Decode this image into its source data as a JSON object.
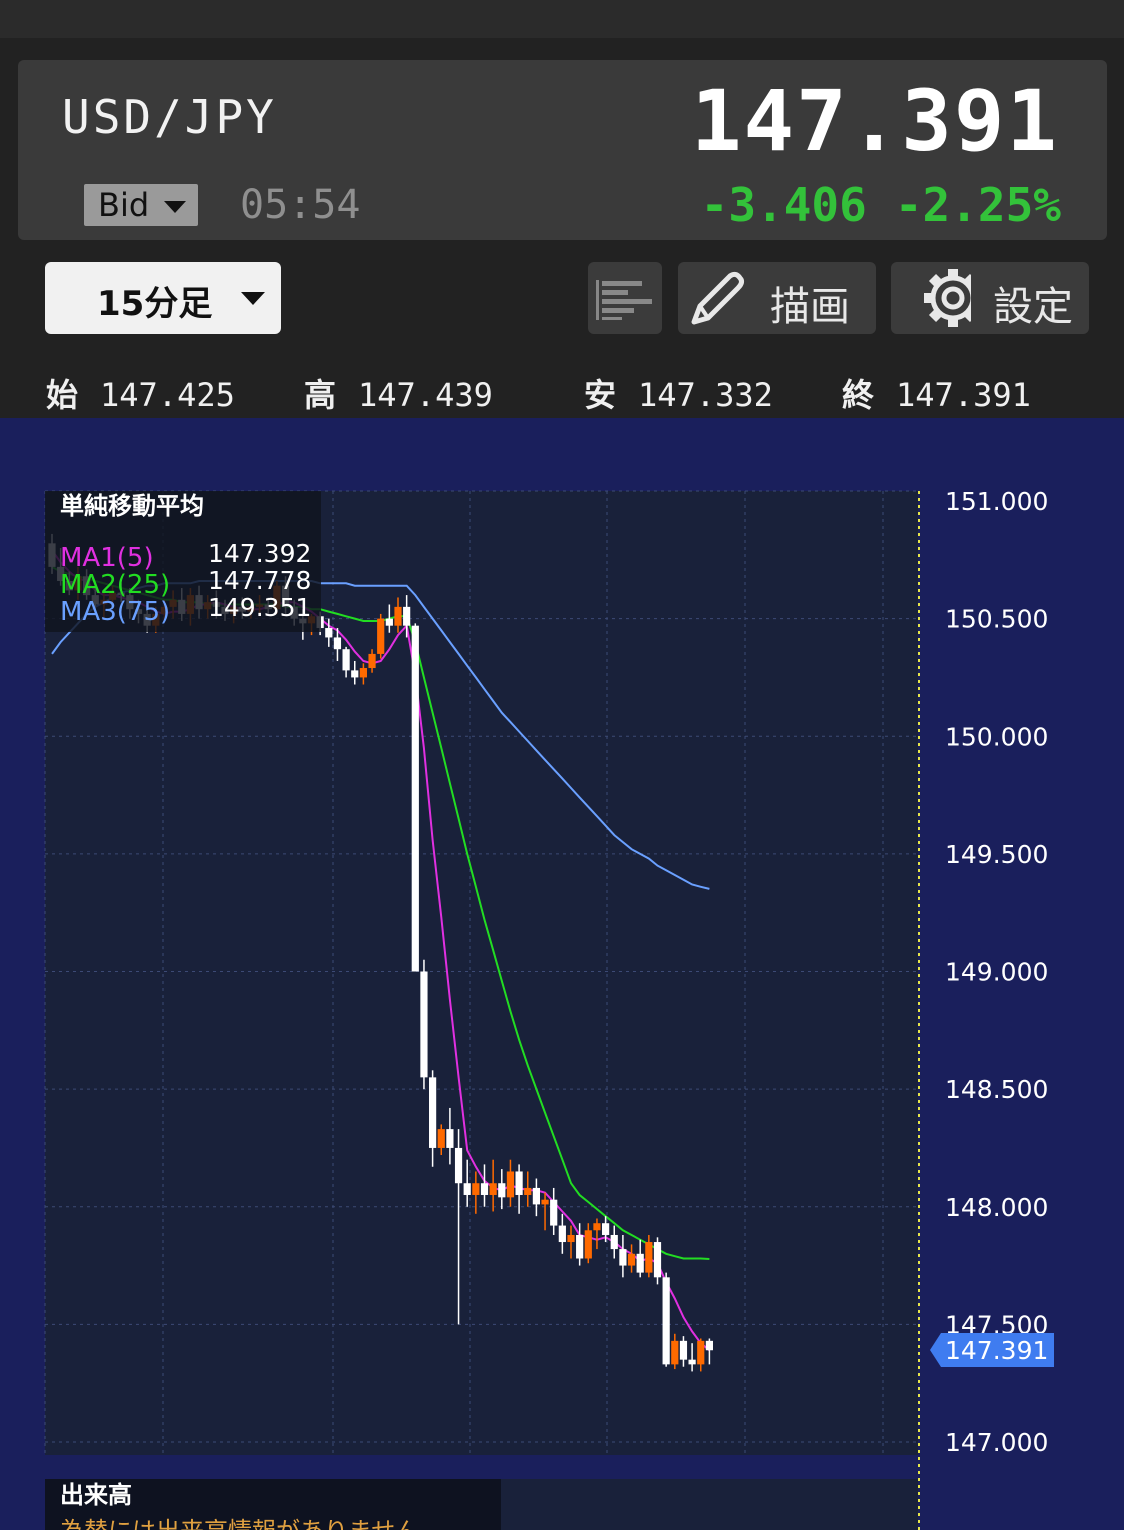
{
  "header": {
    "symbol": "USD/JPY",
    "price": "147.391",
    "price_type": "Bid",
    "time": "05:54",
    "change": "-3.406",
    "change_pct": "-2.25%",
    "down_color": "#33c23a"
  },
  "toolbar": {
    "timeframe": "15分足",
    "list_icon": "list-icon",
    "draw_label": "描画",
    "draw_icon": "pencil-icon",
    "settings_label": "設定",
    "settings_icon": "gear-icon"
  },
  "ohlc": {
    "open_label": "始",
    "open": "147.425",
    "high_label": "高",
    "high": "147.439",
    "low_label": "安",
    "low": "147.332",
    "close_label": "終",
    "close": "147.391"
  },
  "legend": {
    "title": "単純移動平均",
    "ma1_label": "MA1(5)",
    "ma1_value": "147.392",
    "ma1_color": "#e030e0",
    "ma2_label": "MA2(25)",
    "ma2_value": "147.778",
    "ma2_color": "#22dd22",
    "ma3_label": "MA3(75)",
    "ma3_value": "149.351",
    "ma3_color": "#6aa0ff"
  },
  "volume": {
    "title": "出来高",
    "message": "為替には出来高情報がありません"
  },
  "chart_data": {
    "type": "candlestick",
    "ylim": [
      147.0,
      151.0
    ],
    "y_ticks": [
      "151.000",
      "150.500",
      "150.000",
      "149.500",
      "149.000",
      "148.500",
      "148.000",
      "147.500",
      "147.000"
    ],
    "current_price_label": "147.391",
    "up_color": "#ff6a00",
    "down_color": "#ffffff",
    "candles": [
      [
        150.82,
        150.86,
        150.69,
        150.72
      ],
      [
        150.72,
        150.8,
        150.64,
        150.66
      ],
      [
        150.66,
        150.7,
        150.6,
        150.62
      ],
      [
        150.62,
        150.72,
        150.58,
        150.68
      ],
      [
        150.68,
        150.71,
        150.58,
        150.6
      ],
      [
        150.6,
        150.63,
        150.53,
        150.56
      ],
      [
        150.56,
        150.62,
        150.5,
        150.58
      ],
      [
        150.58,
        150.64,
        150.55,
        150.61
      ],
      [
        150.61,
        150.65,
        150.57,
        150.6
      ],
      [
        150.6,
        150.63,
        150.5,
        150.54
      ],
      [
        150.54,
        150.58,
        150.48,
        150.52
      ],
      [
        150.52,
        150.57,
        150.44,
        150.47
      ],
      [
        150.47,
        150.55,
        150.44,
        150.52
      ],
      [
        150.52,
        150.58,
        150.49,
        150.55
      ],
      [
        150.55,
        150.62,
        150.5,
        150.58
      ],
      [
        150.58,
        150.63,
        150.49,
        150.52
      ],
      [
        150.52,
        150.63,
        150.47,
        150.6
      ],
      [
        150.6,
        150.64,
        150.5,
        150.54
      ],
      [
        150.54,
        150.6,
        150.5,
        150.57
      ],
      [
        150.57,
        150.62,
        150.5,
        150.55
      ],
      [
        150.55,
        150.58,
        150.49,
        150.52
      ],
      [
        150.52,
        150.58,
        150.48,
        150.55
      ],
      [
        150.55,
        150.59,
        150.5,
        150.53
      ],
      [
        150.53,
        150.57,
        150.5,
        150.55
      ],
      [
        150.55,
        150.6,
        150.51,
        150.56
      ],
      [
        150.56,
        150.59,
        150.52,
        150.54
      ],
      [
        150.54,
        150.66,
        150.52,
        150.64
      ],
      [
        150.64,
        150.68,
        150.52,
        150.55
      ],
      [
        150.55,
        150.58,
        150.47,
        150.5
      ],
      [
        150.5,
        150.54,
        150.41,
        150.48
      ],
      [
        150.48,
        150.52,
        150.43,
        150.51
      ],
      [
        150.51,
        150.53,
        150.43,
        150.46
      ],
      [
        150.46,
        150.5,
        150.38,
        150.42
      ],
      [
        150.42,
        150.46,
        150.32,
        150.37
      ],
      [
        150.37,
        150.38,
        150.25,
        150.28
      ],
      [
        150.28,
        150.32,
        150.22,
        150.25
      ],
      [
        150.25,
        150.31,
        150.22,
        150.29
      ],
      [
        150.29,
        150.37,
        150.27,
        150.35
      ],
      [
        150.35,
        150.52,
        150.33,
        150.5
      ],
      [
        150.5,
        150.56,
        150.44,
        150.47
      ],
      [
        150.47,
        150.59,
        150.44,
        150.55
      ],
      [
        150.55,
        150.6,
        150.42,
        150.47
      ],
      [
        150.47,
        150.48,
        149.0,
        149.0
      ],
      [
        149.0,
        149.05,
        148.5,
        148.55
      ],
      [
        148.55,
        148.58,
        148.17,
        148.25
      ],
      [
        148.25,
        148.35,
        148.22,
        148.33
      ],
      [
        148.33,
        148.42,
        148.18,
        148.25
      ],
      [
        148.25,
        148.33,
        147.5,
        148.1
      ],
      [
        148.1,
        148.2,
        148.0,
        148.05
      ],
      [
        148.05,
        148.15,
        147.97,
        148.1
      ],
      [
        148.1,
        148.18,
        148.0,
        148.05
      ],
      [
        148.05,
        148.2,
        147.98,
        148.1
      ],
      [
        148.1,
        148.16,
        147.99,
        148.04
      ],
      [
        148.04,
        148.2,
        148.0,
        148.15
      ],
      [
        148.15,
        148.18,
        147.97,
        148.05
      ],
      [
        148.05,
        148.15,
        148.0,
        148.08
      ],
      [
        148.08,
        148.12,
        147.96,
        148.01
      ],
      [
        148.01,
        148.06,
        147.9,
        148.03
      ],
      [
        148.03,
        148.08,
        147.88,
        147.92
      ],
      [
        147.92,
        147.97,
        147.8,
        147.85
      ],
      [
        147.85,
        147.92,
        147.78,
        147.88
      ],
      [
        147.88,
        147.93,
        147.75,
        147.78
      ],
      [
        147.78,
        147.93,
        147.76,
        147.9
      ],
      [
        147.9,
        147.95,
        147.82,
        147.93
      ],
      [
        147.93,
        147.96,
        147.85,
        147.88
      ],
      [
        147.88,
        147.92,
        147.78,
        147.82
      ],
      [
        147.82,
        147.88,
        147.7,
        147.75
      ],
      [
        147.75,
        147.84,
        147.72,
        147.8
      ],
      [
        147.8,
        147.86,
        147.7,
        147.72
      ],
      [
        147.72,
        147.88,
        147.7,
        147.85
      ],
      [
        147.85,
        147.87,
        147.67,
        147.7
      ],
      [
        147.7,
        147.72,
        147.32,
        147.33
      ],
      [
        147.33,
        147.46,
        147.31,
        147.43
      ],
      [
        147.43,
        147.45,
        147.32,
        147.35
      ],
      [
        147.35,
        147.42,
        147.3,
        147.33
      ],
      [
        147.33,
        147.44,
        147.3,
        147.43
      ],
      [
        147.43,
        147.44,
        147.33,
        147.39
      ]
    ],
    "ma1_values": [
      150.79,
      150.74,
      150.7,
      150.67,
      150.66,
      150.62,
      150.6,
      150.6,
      150.59,
      150.58,
      150.57,
      150.55,
      150.53,
      150.52,
      150.53,
      150.53,
      150.54,
      150.56,
      150.56,
      150.57,
      150.56,
      150.55,
      150.54,
      150.54,
      150.54,
      150.55,
      150.56,
      150.57,
      150.57,
      150.55,
      150.53,
      150.5,
      150.47,
      150.45,
      150.41,
      150.36,
      150.32,
      150.31,
      150.32,
      150.37,
      150.43,
      150.47,
      150.26,
      149.95,
      149.56,
      149.23,
      148.88,
      148.55,
      148.24,
      148.17,
      148.11,
      148.08,
      148.07,
      148.09,
      148.08,
      148.07,
      148.07,
      148.06,
      148.02,
      147.98,
      147.94,
      147.88,
      147.87,
      147.86,
      147.87,
      147.85,
      147.82,
      147.8,
      147.77,
      147.78,
      147.76,
      147.68,
      147.61,
      147.53,
      147.47,
      147.42,
      147.39
    ],
    "ma2_values": [
      150.72,
      150.7,
      150.69,
      150.68,
      150.67,
      150.66,
      150.65,
      150.64,
      150.63,
      150.62,
      150.61,
      150.6,
      150.59,
      150.58,
      150.58,
      150.57,
      150.57,
      150.57,
      150.56,
      150.56,
      150.56,
      150.56,
      150.56,
      150.56,
      150.56,
      150.56,
      150.56,
      150.55,
      150.55,
      150.55,
      150.54,
      150.54,
      150.53,
      150.52,
      150.51,
      150.5,
      150.49,
      150.49,
      150.49,
      150.5,
      150.51,
      150.51,
      150.4,
      150.25,
      150.1,
      149.95,
      149.8,
      149.65,
      149.5,
      149.36,
      149.22,
      149.09,
      148.96,
      148.83,
      148.71,
      148.6,
      148.5,
      148.4,
      148.3,
      148.2,
      148.1,
      148.05,
      148.02,
      147.99,
      147.96,
      147.93,
      147.9,
      147.88,
      147.86,
      147.84,
      147.82,
      147.8,
      147.79,
      147.78,
      147.78,
      147.78,
      147.778
    ],
    "ma3_values": [
      150.35,
      150.4,
      150.44,
      150.48,
      150.52,
      150.55,
      150.57,
      150.59,
      150.61,
      150.62,
      150.63,
      150.64,
      150.64,
      150.65,
      150.65,
      150.65,
      150.65,
      150.66,
      150.66,
      150.66,
      150.66,
      150.66,
      150.66,
      150.66,
      150.66,
      150.66,
      150.66,
      150.66,
      150.66,
      150.66,
      150.66,
      150.65,
      150.65,
      150.65,
      150.65,
      150.64,
      150.64,
      150.64,
      150.64,
      150.64,
      150.64,
      150.64,
      150.6,
      150.55,
      150.5,
      150.45,
      150.4,
      150.35,
      150.3,
      150.25,
      150.2,
      150.15,
      150.1,
      150.06,
      150.02,
      149.98,
      149.94,
      149.9,
      149.86,
      149.82,
      149.78,
      149.74,
      149.7,
      149.66,
      149.62,
      149.58,
      149.55,
      149.52,
      149.5,
      149.48,
      149.45,
      149.43,
      149.41,
      149.39,
      149.37,
      149.36,
      149.351
    ]
  }
}
